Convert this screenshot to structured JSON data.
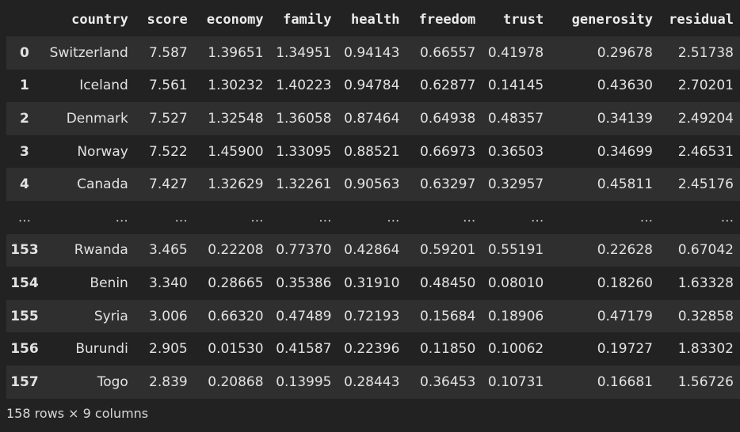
{
  "table": {
    "columns": [
      "",
      "country",
      "score",
      "economy",
      "family",
      "health",
      "freedom",
      "trust",
      "generosity",
      "residual"
    ],
    "rows": [
      [
        "0",
        "Switzerland",
        "7.587",
        "1.39651",
        "1.34951",
        "0.94143",
        "0.66557",
        "0.41978",
        "0.29678",
        "2.51738"
      ],
      [
        "1",
        "Iceland",
        "7.561",
        "1.30232",
        "1.40223",
        "0.94784",
        "0.62877",
        "0.14145",
        "0.43630",
        "2.70201"
      ],
      [
        "2",
        "Denmark",
        "7.527",
        "1.32548",
        "1.36058",
        "0.87464",
        "0.64938",
        "0.48357",
        "0.34139",
        "2.49204"
      ],
      [
        "3",
        "Norway",
        "7.522",
        "1.45900",
        "1.33095",
        "0.88521",
        "0.66973",
        "0.36503",
        "0.34699",
        "2.46531"
      ],
      [
        "4",
        "Canada",
        "7.427",
        "1.32629",
        "1.32261",
        "0.90563",
        "0.63297",
        "0.32957",
        "0.45811",
        "2.45176"
      ],
      [
        "...",
        "...",
        "...",
        "...",
        "...",
        "...",
        "...",
        "...",
        "...",
        "..."
      ],
      [
        "153",
        "Rwanda",
        "3.465",
        "0.22208",
        "0.77370",
        "0.42864",
        "0.59201",
        "0.55191",
        "0.22628",
        "0.67042"
      ],
      [
        "154",
        "Benin",
        "3.340",
        "0.28665",
        "0.35386",
        "0.31910",
        "0.48450",
        "0.08010",
        "0.18260",
        "1.63328"
      ],
      [
        "155",
        "Syria",
        "3.006",
        "0.66320",
        "0.47489",
        "0.72193",
        "0.15684",
        "0.18906",
        "0.47179",
        "0.32858"
      ],
      [
        "156",
        "Burundi",
        "2.905",
        "0.01530",
        "0.41587",
        "0.22396",
        "0.11850",
        "0.10062",
        "0.19727",
        "1.83302"
      ],
      [
        "157",
        "Togo",
        "2.839",
        "0.20868",
        "0.13995",
        "0.28443",
        "0.36453",
        "0.10731",
        "0.16681",
        "1.56726"
      ]
    ]
  },
  "footer": {
    "summary": "158 rows × 9 columns"
  },
  "colors": {
    "background": "#222222",
    "row_stripe": "#2f2f2f",
    "text": "#e2e2e2"
  }
}
